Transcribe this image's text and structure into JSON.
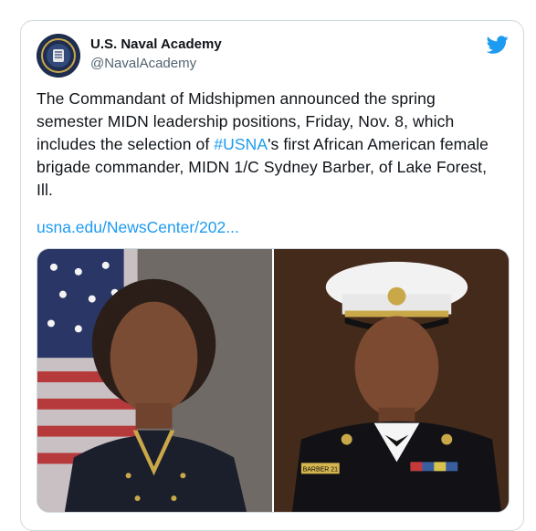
{
  "author": {
    "name": "U.S. Naval Academy",
    "handle": "@NavalAcademy"
  },
  "tweet": {
    "text_part1": "The Commandant of Midshipmen announced the spring semester MIDN leadership positions, Friday, Nov. 8, which includes the selection of ",
    "hashtag": "#USNA",
    "text_part2": "'s first African American female brigade commander, MIDN 1/C Sydney Barber, of Lake Forest, Ill.",
    "link": "usna.edu/NewsCenter/202..."
  },
  "media": {
    "name_tag": "BARBER 21"
  },
  "icons": {
    "brand": "twitter-bird-icon",
    "brand_color": "#1d9bf0"
  },
  "colors": {
    "link": "#1d9bf0",
    "text": "#0f1419",
    "secondary": "#536471"
  }
}
